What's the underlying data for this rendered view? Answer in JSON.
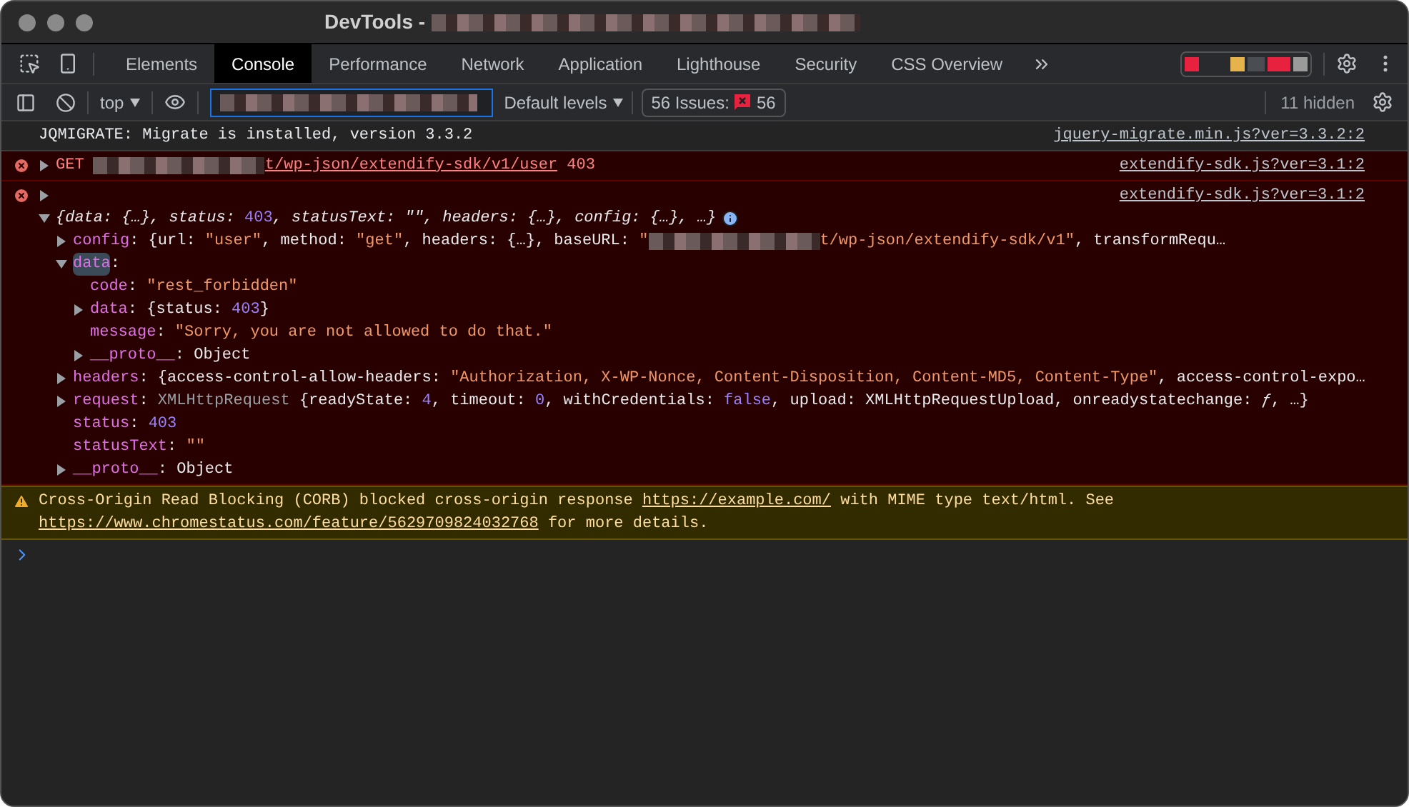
{
  "window": {
    "title": "DevTools -"
  },
  "panel_tabs": [
    {
      "label": "Elements",
      "selected": false
    },
    {
      "label": "Console",
      "selected": true
    },
    {
      "label": "Performance",
      "selected": false
    },
    {
      "label": "Network",
      "selected": false
    },
    {
      "label": "Application",
      "selected": false
    },
    {
      "label": "Lighthouse",
      "selected": false
    },
    {
      "label": "Security",
      "selected": false
    },
    {
      "label": "CSS Overview",
      "selected": false
    }
  ],
  "toolbar": {
    "context": "top",
    "levels": "Default levels",
    "issues_label": "56 Issues:",
    "issues_count": "56",
    "hidden": "11 hidden"
  },
  "messages": [
    {
      "kind": "log",
      "tokens": [
        {
          "kind": "plain",
          "s": "JQMIGRATE: Migrate is installed, version 3.3.2"
        }
      ],
      "source": "jquery-migrate.min.js?ver=3.3.2:2"
    },
    {
      "kind": "error",
      "expandable": true,
      "expanded": false,
      "tokens": [
        {
          "kind": "plain",
          "s": "GET "
        },
        {
          "kind": "redacted"
        },
        {
          "kind": "link",
          "s": "t/wp-json/extendify-sdk/v1/user"
        },
        {
          "kind": "plain",
          "s": " 403"
        }
      ],
      "source": "extendify-sdk.js?ver=3.1:2"
    },
    {
      "kind": "error",
      "expandable": true,
      "expanded": false,
      "source": "extendify-sdk.js?ver=3.1:2",
      "tree": [
        {
          "expandable": true,
          "expanded": true,
          "selected": false,
          "info": true,
          "tokens": [
            {
              "kind": "italic",
              "s": "{data: {…}, status: "
            },
            {
              "kind": "number",
              "s": "403"
            },
            {
              "kind": "italic",
              "s": ", statusText: \"\", headers: {…}, config: {…}, …}"
            }
          ],
          "children": [
            {
              "expandable": true,
              "expanded": false,
              "selected": false,
              "tokens": [
                {
                  "kind": "key",
                  "s": "config"
                },
                {
                  "kind": "punct",
                  "s": ": {url: "
                },
                {
                  "kind": "string",
                  "s": "\"user\""
                },
                {
                  "kind": "punct",
                  "s": ", method: "
                },
                {
                  "kind": "string",
                  "s": "\"get\""
                },
                {
                  "kind": "punct",
                  "s": ", headers: {…}, baseURL: "
                },
                {
                  "kind": "string",
                  "s": "\""
                },
                {
                  "kind": "redacted"
                },
                {
                  "kind": "string",
                  "s": "t/wp-json/extendify-sdk/v1\""
                },
                {
                  "kind": "punct",
                  "s": ", transformRequ…"
                }
              ]
            },
            {
              "expandable": true,
              "expanded": true,
              "selected": true,
              "tokens": [
                {
                  "kind": "key",
                  "s": "data"
                },
                {
                  "kind": "punct",
                  "s": ":"
                }
              ],
              "children": [
                {
                  "expandable": false,
                  "selected": false,
                  "tokens": [
                    {
                      "kind": "key",
                      "s": "code"
                    },
                    {
                      "kind": "punct",
                      "s": ": "
                    },
                    {
                      "kind": "string",
                      "s": "\"rest_forbidden\""
                    }
                  ]
                },
                {
                  "expandable": true,
                  "expanded": false,
                  "selected": false,
                  "tokens": [
                    {
                      "kind": "key",
                      "s": "data"
                    },
                    {
                      "kind": "punct",
                      "s": ": {status: "
                    },
                    {
                      "kind": "number",
                      "s": "403"
                    },
                    {
                      "kind": "punct",
                      "s": "}"
                    }
                  ]
                },
                {
                  "expandable": false,
                  "selected": false,
                  "tokens": [
                    {
                      "kind": "key",
                      "s": "message"
                    },
                    {
                      "kind": "punct",
                      "s": ": "
                    },
                    {
                      "kind": "string",
                      "s": "\"Sorry, you are not allowed to do that.\""
                    }
                  ]
                },
                {
                  "expandable": true,
                  "expanded": false,
                  "selected": false,
                  "tokens": [
                    {
                      "kind": "key",
                      "s": "__proto__"
                    },
                    {
                      "kind": "punct",
                      "s": ": Object"
                    }
                  ]
                }
              ]
            },
            {
              "expandable": true,
              "expanded": false,
              "selected": false,
              "tokens": [
                {
                  "kind": "key",
                  "s": "headers"
                },
                {
                  "kind": "punct",
                  "s": ": {access-control-allow-headers: "
                },
                {
                  "kind": "string",
                  "s": "\"Authorization, X-WP-Nonce, Content-Disposition, Content-MD5, Content-Type\""
                },
                {
                  "kind": "punct",
                  "s": ", access-control-expo…"
                }
              ]
            },
            {
              "expandable": true,
              "expanded": false,
              "selected": false,
              "tokens": [
                {
                  "kind": "key",
                  "s": "request"
                },
                {
                  "kind": "punct",
                  "s": ": "
                },
                {
                  "kind": "dim",
                  "s": "XMLHttpRequest"
                },
                {
                  "kind": "punct",
                  "s": " {readyState: "
                },
                {
                  "kind": "number",
                  "s": "4"
                },
                {
                  "kind": "punct",
                  "s": ", timeout: "
                },
                {
                  "kind": "number",
                  "s": "0"
                },
                {
                  "kind": "punct",
                  "s": ", withCredentials: "
                },
                {
                  "kind": "number",
                  "s": "false"
                },
                {
                  "kind": "punct",
                  "s": ", upload: XMLHttpRequestUpload, onreadystatechange: "
                },
                {
                  "kind": "italic",
                  "s": "ƒ"
                },
                {
                  "kind": "punct",
                  "s": ", …}"
                }
              ]
            },
            {
              "expandable": false,
              "selected": false,
              "tokens": [
                {
                  "kind": "key",
                  "s": "status"
                },
                {
                  "kind": "punct",
                  "s": ": "
                },
                {
                  "kind": "number",
                  "s": "403"
                }
              ]
            },
            {
              "expandable": false,
              "selected": false,
              "tokens": [
                {
                  "kind": "key",
                  "s": "statusText"
                },
                {
                  "kind": "punct",
                  "s": ": "
                },
                {
                  "kind": "string",
                  "s": "\"\""
                }
              ]
            },
            {
              "expandable": true,
              "expanded": false,
              "selected": false,
              "tokens": [
                {
                  "kind": "key",
                  "s": "__proto__"
                },
                {
                  "kind": "punct",
                  "s": ": Object"
                }
              ]
            }
          ]
        }
      ]
    },
    {
      "kind": "warning",
      "tokens": [
        {
          "kind": "plain",
          "s": "Cross-Origin Read Blocking (CORB) blocked cross-origin response "
        },
        {
          "kind": "link",
          "s": "https://example.com/"
        },
        {
          "kind": "plain",
          "s": " with MIME type text/html. See "
        },
        {
          "kind": "link",
          "s": "https://www.chromestatus.com/feature/5629709824032768"
        },
        {
          "kind": "plain",
          "s": " for more details."
        }
      ]
    }
  ]
}
